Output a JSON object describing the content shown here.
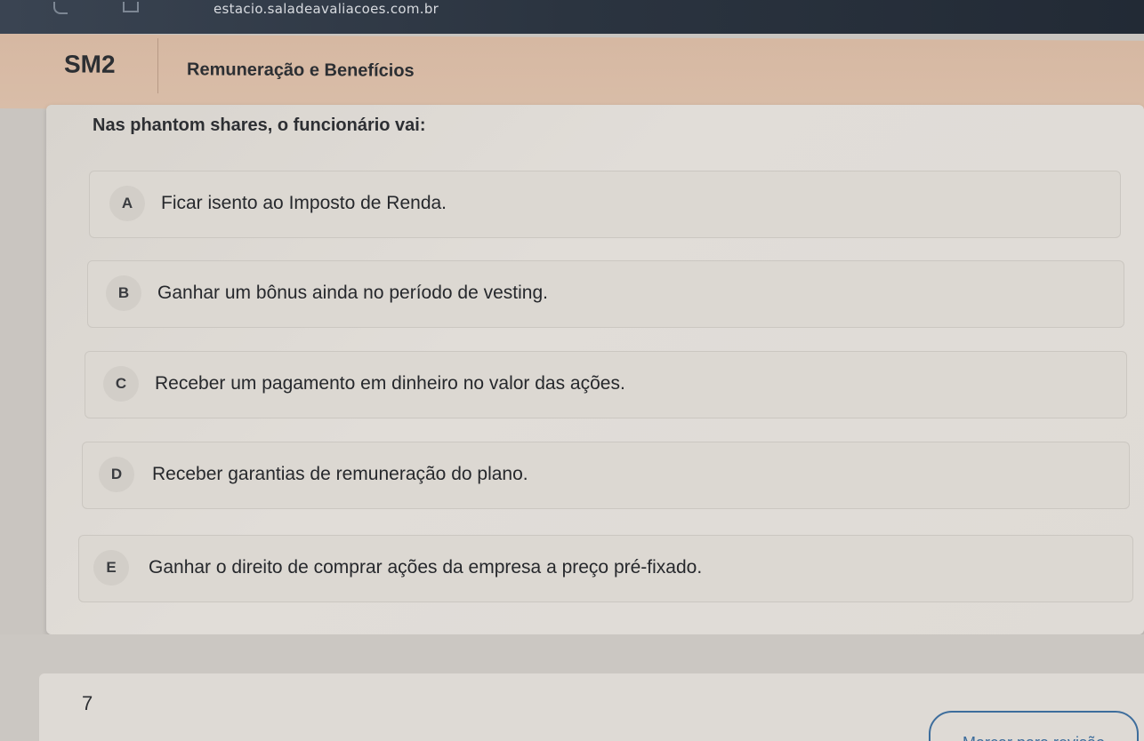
{
  "browser": {
    "url": "estacio.saladeavaliacoes.com.br"
  },
  "header": {
    "course_code": "SM2",
    "subject_title": "Remuneração e Benefícios"
  },
  "question": {
    "text": "Nas phantom shares, o funcionário vai:",
    "options": [
      {
        "letter": "A",
        "text": "Ficar isento ao Imposto de Renda."
      },
      {
        "letter": "B",
        "text": "Ganhar um bônus ainda no período de vesting."
      },
      {
        "letter": "C",
        "text": "Receber um pagamento em dinheiro no valor das ações."
      },
      {
        "letter": "D",
        "text": "Receber garantias de remuneração do plano."
      },
      {
        "letter": "E",
        "text": "Ganhar o direito de comprar ações da empresa a preço pré-fixado."
      }
    ]
  },
  "footer": {
    "question_number": "7",
    "review_button_label": "Marcar para revisão"
  },
  "colors": {
    "header_bg": "#d6b8a2",
    "card_bg": "#dcd8d2",
    "accent": "#3d6d9c"
  }
}
